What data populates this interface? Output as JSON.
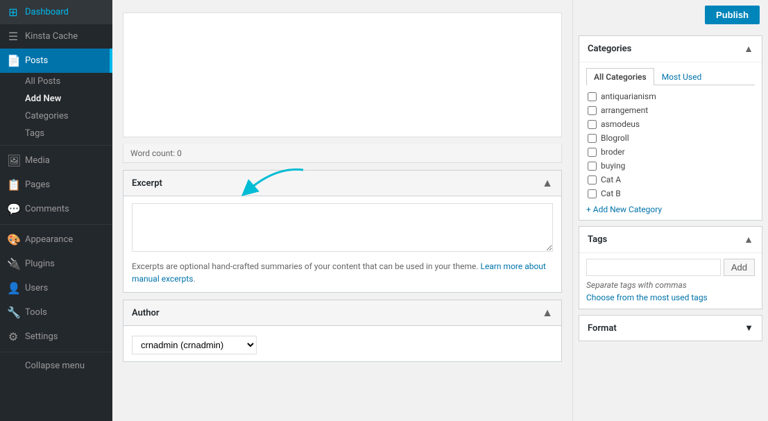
{
  "sidebar": {
    "items": [
      {
        "id": "dashboard",
        "label": "Dashboard",
        "icon": "⊞"
      },
      {
        "id": "kinsta-cache",
        "label": "Kinsta Cache",
        "icon": "☰"
      },
      {
        "id": "posts",
        "label": "Posts",
        "icon": "📄",
        "active": true
      },
      {
        "id": "media",
        "label": "Media",
        "icon": "🖼"
      },
      {
        "id": "pages",
        "label": "Pages",
        "icon": "📋"
      },
      {
        "id": "comments",
        "label": "Comments",
        "icon": "💬"
      },
      {
        "id": "appearance",
        "label": "Appearance",
        "icon": "🎨"
      },
      {
        "id": "plugins",
        "label": "Plugins",
        "icon": "🔌"
      },
      {
        "id": "users",
        "label": "Users",
        "icon": "👤"
      },
      {
        "id": "tools",
        "label": "Tools",
        "icon": "🔧"
      },
      {
        "id": "settings",
        "label": "Settings",
        "icon": "⚙"
      }
    ],
    "posts_subitems": [
      {
        "id": "all-posts",
        "label": "All Posts"
      },
      {
        "id": "add-new",
        "label": "Add New",
        "bold": true
      },
      {
        "id": "categories",
        "label": "Categories"
      },
      {
        "id": "tags",
        "label": "Tags"
      }
    ],
    "collapse_label": "Collapse menu"
  },
  "main": {
    "word_count_label": "Word count: 0",
    "excerpt": {
      "title": "Excerpt",
      "textarea_placeholder": "",
      "note": "Excerpts are optional hand-crafted summaries of your content that can be used in your theme.",
      "note_link_text": "Learn more about manual excerpts",
      "note_link_href": "#",
      "toggle_symbol": "▲"
    },
    "author": {
      "title": "Author",
      "value": "crnadmin (crnadmin)",
      "toggle_symbol": "▲"
    }
  },
  "right_sidebar": {
    "publish_btn_label": "Publish",
    "categories": {
      "title": "Categories",
      "toggle_symbol": "▲",
      "tab_all": "All Categories",
      "tab_most_used": "Most Used",
      "active_tab": "all",
      "items": [
        {
          "id": "antiquarianism",
          "label": "antiquarianism",
          "checked": false
        },
        {
          "id": "arrangement",
          "label": "arrangement",
          "checked": false
        },
        {
          "id": "asmodeus",
          "label": "asmodeus",
          "checked": false
        },
        {
          "id": "blogroll",
          "label": "Blogroll",
          "checked": false
        },
        {
          "id": "broder",
          "label": "broder",
          "checked": false
        },
        {
          "id": "buying",
          "label": "buying",
          "checked": false
        },
        {
          "id": "cat-a",
          "label": "Cat A",
          "checked": false
        },
        {
          "id": "cat-b",
          "label": "Cat B",
          "checked": false
        }
      ],
      "add_new_label": "+ Add New Category"
    },
    "tags": {
      "title": "Tags",
      "toggle_symbol": "▲",
      "add_btn_label": "Add",
      "hint": "Separate tags with commas",
      "most_used_link": "Choose from the most used tags"
    },
    "format": {
      "title": "Format",
      "toggle_symbol": "▼"
    }
  }
}
